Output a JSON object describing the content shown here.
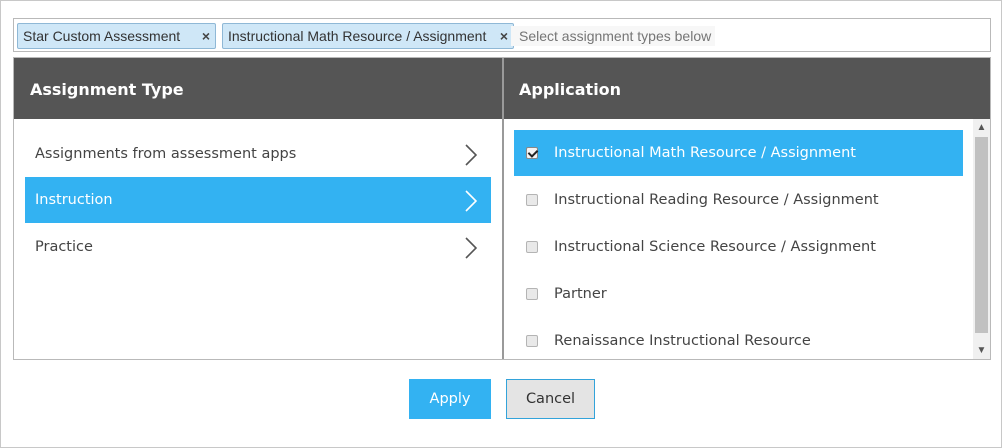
{
  "tags": [
    {
      "label": "Star Custom Assessment",
      "remove": "×"
    },
    {
      "label": "Instructional Math Resource / Assignment",
      "remove": "×"
    }
  ],
  "tag_input": {
    "placeholder": "Select assignment types below"
  },
  "assignment_type": {
    "header": "Assignment Type",
    "items": [
      {
        "label": "Assignments from assessment apps",
        "selected": false
      },
      {
        "label": "Instruction",
        "selected": true
      },
      {
        "label": "Practice",
        "selected": false
      }
    ]
  },
  "application": {
    "header": "Application",
    "items": [
      {
        "label": "Instructional Math Resource / Assignment",
        "checked": true,
        "selected": true
      },
      {
        "label": "Instructional Reading Resource / Assignment",
        "checked": false,
        "selected": false
      },
      {
        "label": "Instructional Science Resource / Assignment",
        "checked": false,
        "selected": false
      },
      {
        "label": "Partner",
        "checked": false,
        "selected": false
      },
      {
        "label": "Renaissance Instructional Resource",
        "checked": false,
        "selected": false
      }
    ]
  },
  "buttons": {
    "apply": "Apply",
    "cancel": "Cancel"
  },
  "colors": {
    "accent": "#33b2f2",
    "header_bg": "#555555",
    "tag_bg": "#cfe7f7"
  }
}
